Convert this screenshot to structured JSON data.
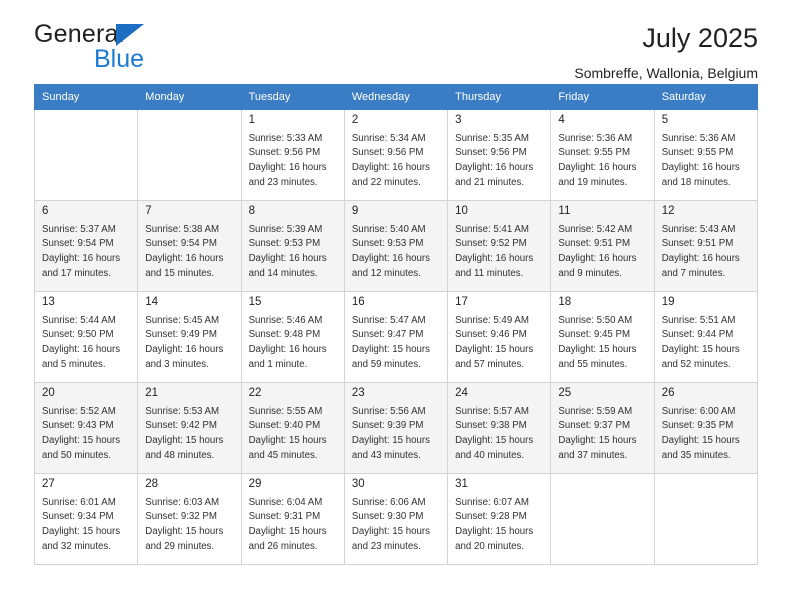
{
  "brand": {
    "name_top": "General",
    "name_bottom": "Blue",
    "triangle_color": "#1b6ec2",
    "blue_color": "#1b7ad4"
  },
  "header": {
    "title": "July 2025",
    "location": "Sombreffe, Wallonia, Belgium"
  },
  "theme": {
    "header_bg": "#3b7dc4",
    "header_text": "#ffffff",
    "alt_row_bg": "#f4f4f4",
    "grid_border": "#d4d4d4"
  },
  "weekday_headers": [
    "Sunday",
    "Monday",
    "Tuesday",
    "Wednesday",
    "Thursday",
    "Friday",
    "Saturday"
  ],
  "labels": {
    "sunrise_prefix": "Sunrise:",
    "sunset_prefix": "Sunset:",
    "daylight_prefix": "Daylight:"
  },
  "weeks": [
    [
      {
        "day": "",
        "line1": "",
        "line2": "",
        "line3": "",
        "line4": ""
      },
      {
        "day": "",
        "line1": "",
        "line2": "",
        "line3": "",
        "line4": ""
      },
      {
        "day": "1",
        "line1": "Sunrise: 5:33 AM",
        "line2": "Sunset: 9:56 PM",
        "line3": "Daylight: 16 hours",
        "line4": "and 23 minutes."
      },
      {
        "day": "2",
        "line1": "Sunrise: 5:34 AM",
        "line2": "Sunset: 9:56 PM",
        "line3": "Daylight: 16 hours",
        "line4": "and 22 minutes."
      },
      {
        "day": "3",
        "line1": "Sunrise: 5:35 AM",
        "line2": "Sunset: 9:56 PM",
        "line3": "Daylight: 16 hours",
        "line4": "and 21 minutes."
      },
      {
        "day": "4",
        "line1": "Sunrise: 5:36 AM",
        "line2": "Sunset: 9:55 PM",
        "line3": "Daylight: 16 hours",
        "line4": "and 19 minutes."
      },
      {
        "day": "5",
        "line1": "Sunrise: 5:36 AM",
        "line2": "Sunset: 9:55 PM",
        "line3": "Daylight: 16 hours",
        "line4": "and 18 minutes."
      }
    ],
    [
      {
        "day": "6",
        "line1": "Sunrise: 5:37 AM",
        "line2": "Sunset: 9:54 PM",
        "line3": "Daylight: 16 hours",
        "line4": "and 17 minutes."
      },
      {
        "day": "7",
        "line1": "Sunrise: 5:38 AM",
        "line2": "Sunset: 9:54 PM",
        "line3": "Daylight: 16 hours",
        "line4": "and 15 minutes."
      },
      {
        "day": "8",
        "line1": "Sunrise: 5:39 AM",
        "line2": "Sunset: 9:53 PM",
        "line3": "Daylight: 16 hours",
        "line4": "and 14 minutes."
      },
      {
        "day": "9",
        "line1": "Sunrise: 5:40 AM",
        "line2": "Sunset: 9:53 PM",
        "line3": "Daylight: 16 hours",
        "line4": "and 12 minutes."
      },
      {
        "day": "10",
        "line1": "Sunrise: 5:41 AM",
        "line2": "Sunset: 9:52 PM",
        "line3": "Daylight: 16 hours",
        "line4": "and 11 minutes."
      },
      {
        "day": "11",
        "line1": "Sunrise: 5:42 AM",
        "line2": "Sunset: 9:51 PM",
        "line3": "Daylight: 16 hours",
        "line4": "and 9 minutes."
      },
      {
        "day": "12",
        "line1": "Sunrise: 5:43 AM",
        "line2": "Sunset: 9:51 PM",
        "line3": "Daylight: 16 hours",
        "line4": "and 7 minutes."
      }
    ],
    [
      {
        "day": "13",
        "line1": "Sunrise: 5:44 AM",
        "line2": "Sunset: 9:50 PM",
        "line3": "Daylight: 16 hours",
        "line4": "and 5 minutes."
      },
      {
        "day": "14",
        "line1": "Sunrise: 5:45 AM",
        "line2": "Sunset: 9:49 PM",
        "line3": "Daylight: 16 hours",
        "line4": "and 3 minutes."
      },
      {
        "day": "15",
        "line1": "Sunrise: 5:46 AM",
        "line2": "Sunset: 9:48 PM",
        "line3": "Daylight: 16 hours",
        "line4": "and 1 minute."
      },
      {
        "day": "16",
        "line1": "Sunrise: 5:47 AM",
        "line2": "Sunset: 9:47 PM",
        "line3": "Daylight: 15 hours",
        "line4": "and 59 minutes."
      },
      {
        "day": "17",
        "line1": "Sunrise: 5:49 AM",
        "line2": "Sunset: 9:46 PM",
        "line3": "Daylight: 15 hours",
        "line4": "and 57 minutes."
      },
      {
        "day": "18",
        "line1": "Sunrise: 5:50 AM",
        "line2": "Sunset: 9:45 PM",
        "line3": "Daylight: 15 hours",
        "line4": "and 55 minutes."
      },
      {
        "day": "19",
        "line1": "Sunrise: 5:51 AM",
        "line2": "Sunset: 9:44 PM",
        "line3": "Daylight: 15 hours",
        "line4": "and 52 minutes."
      }
    ],
    [
      {
        "day": "20",
        "line1": "Sunrise: 5:52 AM",
        "line2": "Sunset: 9:43 PM",
        "line3": "Daylight: 15 hours",
        "line4": "and 50 minutes."
      },
      {
        "day": "21",
        "line1": "Sunrise: 5:53 AM",
        "line2": "Sunset: 9:42 PM",
        "line3": "Daylight: 15 hours",
        "line4": "and 48 minutes."
      },
      {
        "day": "22",
        "line1": "Sunrise: 5:55 AM",
        "line2": "Sunset: 9:40 PM",
        "line3": "Daylight: 15 hours",
        "line4": "and 45 minutes."
      },
      {
        "day": "23",
        "line1": "Sunrise: 5:56 AM",
        "line2": "Sunset: 9:39 PM",
        "line3": "Daylight: 15 hours",
        "line4": "and 43 minutes."
      },
      {
        "day": "24",
        "line1": "Sunrise: 5:57 AM",
        "line2": "Sunset: 9:38 PM",
        "line3": "Daylight: 15 hours",
        "line4": "and 40 minutes."
      },
      {
        "day": "25",
        "line1": "Sunrise: 5:59 AM",
        "line2": "Sunset: 9:37 PM",
        "line3": "Daylight: 15 hours",
        "line4": "and 37 minutes."
      },
      {
        "day": "26",
        "line1": "Sunrise: 6:00 AM",
        "line2": "Sunset: 9:35 PM",
        "line3": "Daylight: 15 hours",
        "line4": "and 35 minutes."
      }
    ],
    [
      {
        "day": "27",
        "line1": "Sunrise: 6:01 AM",
        "line2": "Sunset: 9:34 PM",
        "line3": "Daylight: 15 hours",
        "line4": "and 32 minutes."
      },
      {
        "day": "28",
        "line1": "Sunrise: 6:03 AM",
        "line2": "Sunset: 9:32 PM",
        "line3": "Daylight: 15 hours",
        "line4": "and 29 minutes."
      },
      {
        "day": "29",
        "line1": "Sunrise: 6:04 AM",
        "line2": "Sunset: 9:31 PM",
        "line3": "Daylight: 15 hours",
        "line4": "and 26 minutes."
      },
      {
        "day": "30",
        "line1": "Sunrise: 6:06 AM",
        "line2": "Sunset: 9:30 PM",
        "line3": "Daylight: 15 hours",
        "line4": "and 23 minutes."
      },
      {
        "day": "31",
        "line1": "Sunrise: 6:07 AM",
        "line2": "Sunset: 9:28 PM",
        "line3": "Daylight: 15 hours",
        "line4": "and 20 minutes."
      },
      {
        "day": "",
        "line1": "",
        "line2": "",
        "line3": "",
        "line4": ""
      },
      {
        "day": "",
        "line1": "",
        "line2": "",
        "line3": "",
        "line4": ""
      }
    ]
  ]
}
